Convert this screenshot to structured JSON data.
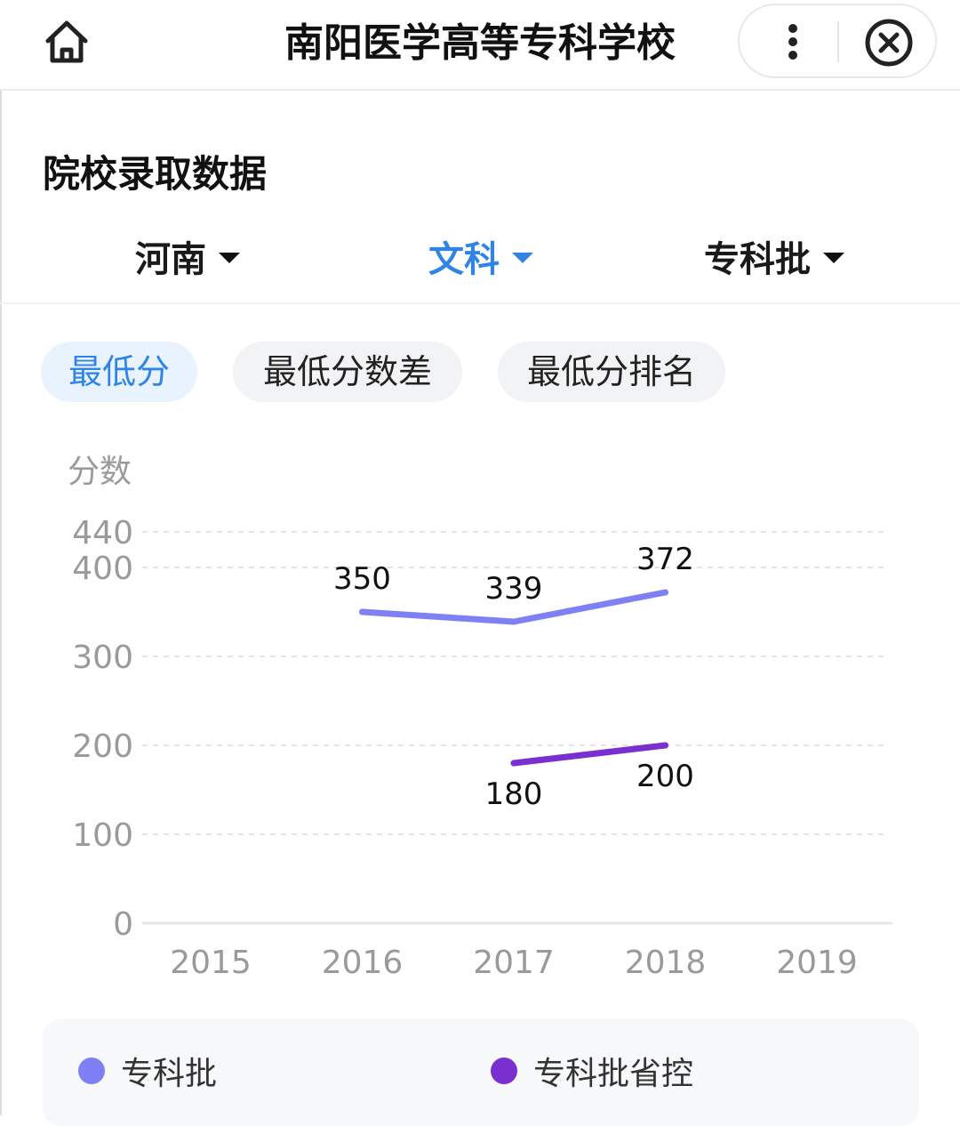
{
  "header": {
    "title": "南阳医学高等专科学校"
  },
  "section": {
    "title": "院校录取数据"
  },
  "filters": [
    {
      "label": "河南",
      "active": false
    },
    {
      "label": "文科",
      "active": true
    },
    {
      "label": "专科批",
      "active": false
    }
  ],
  "tabs": [
    {
      "label": "最低分",
      "active": true
    },
    {
      "label": "最低分数差",
      "active": false
    },
    {
      "label": "最低分排名",
      "active": false
    }
  ],
  "chart_data": {
    "type": "line",
    "ylabel": "分数",
    "yticks": [
      0,
      100,
      200,
      300,
      400,
      440
    ],
    "ylim": [
      0,
      440
    ],
    "categories": [
      "2015",
      "2016",
      "2017",
      "2018",
      "2019"
    ],
    "grid": true,
    "legend_position": "bottom",
    "series": [
      {
        "name": "专科批",
        "color": "#8080f5",
        "values": [
          null,
          350,
          339,
          372,
          null
        ]
      },
      {
        "name": "专科批省控",
        "color": "#7a2fd0",
        "values": [
          null,
          null,
          180,
          200,
          null
        ]
      }
    ]
  }
}
